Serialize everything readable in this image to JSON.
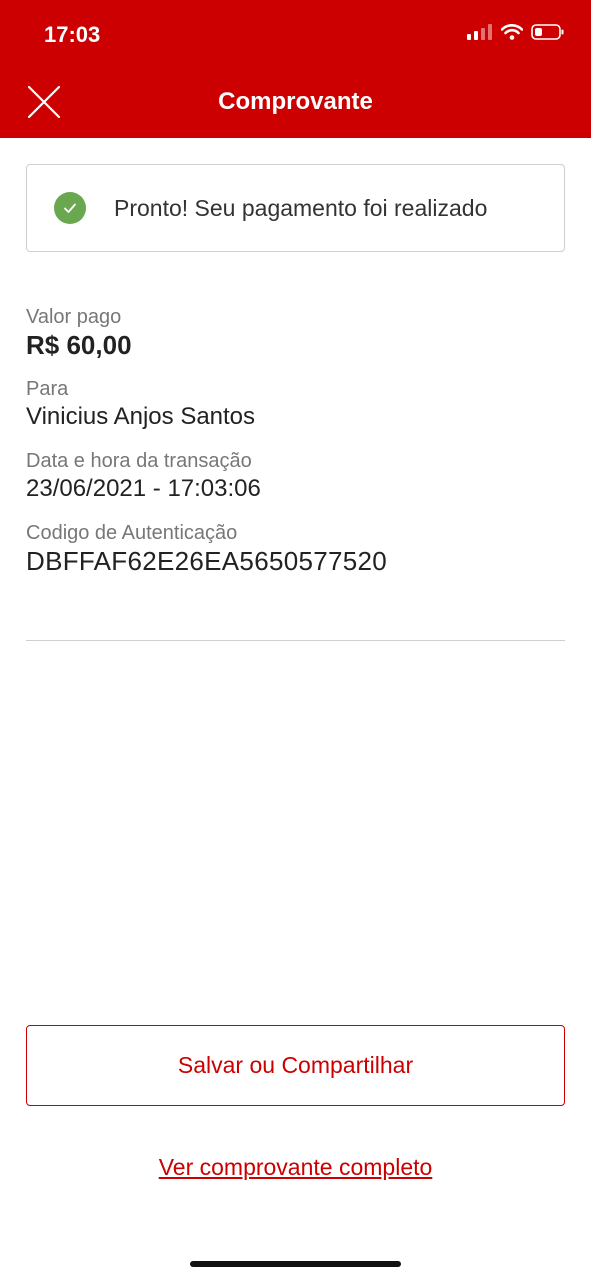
{
  "status_bar": {
    "time": "17:03",
    "icons": [
      "cellular-signal-icon",
      "wifi-icon",
      "battery-icon"
    ]
  },
  "header": {
    "title": "Comprovante",
    "close_icon": "close-icon",
    "background_color": "#cc0000"
  },
  "success": {
    "message": "Pronto! Seu pagamento foi realizado",
    "icon": "check-circle-icon",
    "icon_color": "#6aa84f"
  },
  "details": {
    "amount_label": "Valor pago",
    "amount_value": "R$ 60,00",
    "recipient_label": "Para",
    "recipient_value": "Vinicius Anjos Santos",
    "datetime_label": "Data e hora da transação",
    "datetime_value": "23/06/2021 - 17:03:06",
    "auth_label": "Codigo de Autenticação",
    "auth_value": "DBFFAF62E26EA5650577520"
  },
  "actions": {
    "share_label": "Salvar ou Compartilhar",
    "full_receipt_label": "Ver comprovante completo",
    "accent_color": "#cc0000"
  }
}
